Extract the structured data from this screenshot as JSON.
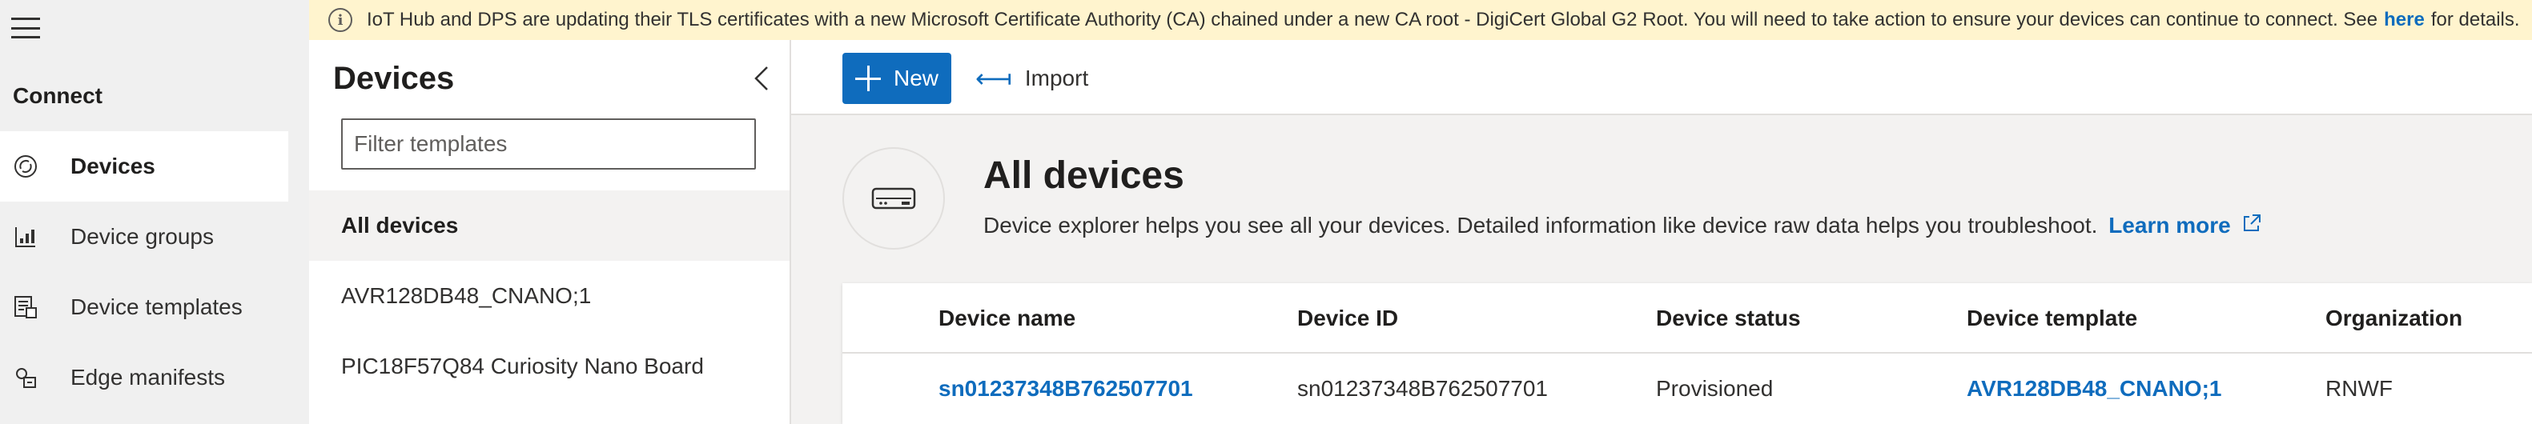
{
  "banner": {
    "text_before": "IoT Hub and DPS are updating their TLS certificates with a new Microsoft Certificate Authority (CA) chained under a new CA root - DigiCert Global G2 Root. You will need to take action to ensure your devices can continue to connect. See",
    "link": "here",
    "text_after": "for details."
  },
  "nav": {
    "section": "Connect",
    "items": [
      {
        "label": "Devices",
        "icon": "devices-icon"
      },
      {
        "label": "Device groups",
        "icon": "device-groups-icon"
      },
      {
        "label": "Device templates",
        "icon": "device-templates-icon"
      },
      {
        "label": "Edge manifests",
        "icon": "edge-manifests-icon"
      }
    ]
  },
  "templates_pane": {
    "title": "Devices",
    "filter_placeholder": "Filter templates",
    "items": [
      {
        "label": "All devices"
      },
      {
        "label": "AVR128DB48_CNANO;1"
      },
      {
        "label": "PIC18F57Q84 Curiosity Nano Board"
      }
    ]
  },
  "toolbar": {
    "new_label": "New",
    "import_label": "Import"
  },
  "hero": {
    "title": "All devices",
    "description": "Device explorer helps you see all your devices. Detailed information like device raw data helps you troubleshoot.",
    "learn_more": "Learn more"
  },
  "table": {
    "columns": [
      "Device name",
      "Device ID",
      "Device status",
      "Device template",
      "Organization"
    ],
    "rows": [
      {
        "device_name": "sn01237348B762507701",
        "device_id": "sn01237348B762507701",
        "device_status": "Provisioned",
        "device_template": "AVR128DB48_CNANO;1",
        "organization": "RNWF"
      }
    ]
  },
  "colors": {
    "accent": "#0f6cbd",
    "banner_bg": "#fff4ce",
    "nav_bg": "#f0f0f0",
    "content_bg": "#f3f2f1"
  }
}
